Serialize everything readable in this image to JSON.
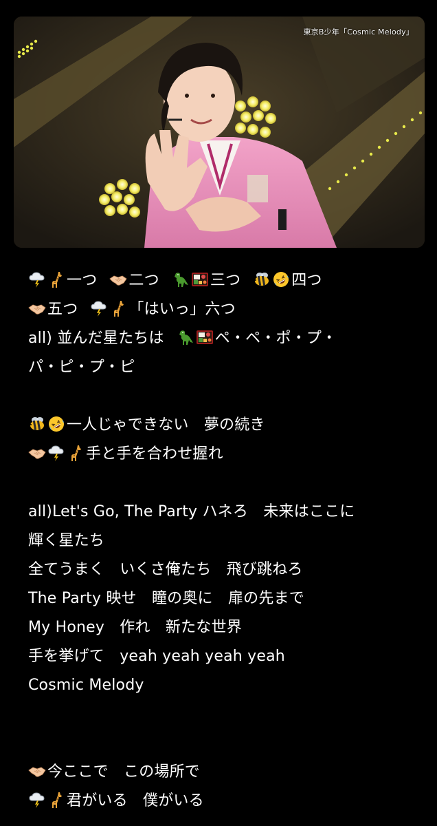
{
  "video": {
    "caption": "東京B少年「Cosmic Melody」"
  },
  "lyrics": [
    {
      "segments": [
        {
          "icons": [
            "cloud-lightning-icon",
            "giraffe-icon"
          ],
          "text": "一つ"
        },
        {
          "icons": [
            "handshake-icon"
          ],
          "text": "二つ"
        },
        {
          "icons": [
            "dinosaur-icon",
            "bento-icon"
          ],
          "text": "三つ"
        },
        {
          "icons": [
            "bee-icon",
            "rofl-face-icon"
          ],
          "text": "四つ"
        }
      ]
    },
    {
      "segments": [
        {
          "icons": [
            "handshake-icon"
          ],
          "text": "五つ"
        },
        {
          "icons": [
            "cloud-lightning-icon",
            "giraffe-icon"
          ],
          "text": "「はいっ」六つ"
        }
      ]
    },
    {
      "segments": [
        {
          "icons": [],
          "text": "all) 並んだ星たちは"
        },
        {
          "icons": [
            "dinosaur-icon",
            "bento-icon"
          ],
          "text": "ペ・ペ・ポ・プ・"
        }
      ]
    },
    {
      "segments": [
        {
          "icons": [],
          "text": "パ・ピ・プ・ピ"
        }
      ]
    },
    {
      "blank": true
    },
    {
      "segments": [
        {
          "icons": [
            "bee-icon",
            "rofl-face-icon"
          ],
          "text": "一人じゃできない　夢の続き"
        }
      ]
    },
    {
      "segments": [
        {
          "icons": [
            "handshake-icon",
            "cloud-lightning-icon",
            "giraffe-icon"
          ],
          "text": "手と手を合わせ握れ"
        }
      ]
    },
    {
      "blank": true
    },
    {
      "segments": [
        {
          "icons": [],
          "text": "all)Let's Go, The Party ハネろ　未来はここに"
        }
      ]
    },
    {
      "segments": [
        {
          "icons": [],
          "text": "輝く星たち"
        }
      ]
    },
    {
      "segments": [
        {
          "icons": [],
          "text": "全てうまく　いくさ俺たち　飛び跳ねろ"
        }
      ]
    },
    {
      "segments": [
        {
          "icons": [],
          "text": "The Party 映せ　瞳の奥に　扉の先まで"
        }
      ]
    },
    {
      "segments": [
        {
          "icons": [],
          "text": "My Honey　作れ　新たな世界"
        }
      ]
    },
    {
      "segments": [
        {
          "icons": [],
          "text": "手を挙げて　yeah yeah yeah yeah"
        }
      ]
    },
    {
      "segments": [
        {
          "icons": [],
          "text": "Cosmic Melody"
        }
      ]
    },
    {
      "blank": true
    },
    {
      "blank": true
    },
    {
      "segments": [
        {
          "icons": [
            "handshake-icon"
          ],
          "text": "今ここで　この場所で"
        }
      ]
    },
    {
      "segments": [
        {
          "icons": [
            "cloud-lightning-icon",
            "giraffe-icon"
          ],
          "text": "君がいる　僕がいる"
        }
      ]
    }
  ]
}
